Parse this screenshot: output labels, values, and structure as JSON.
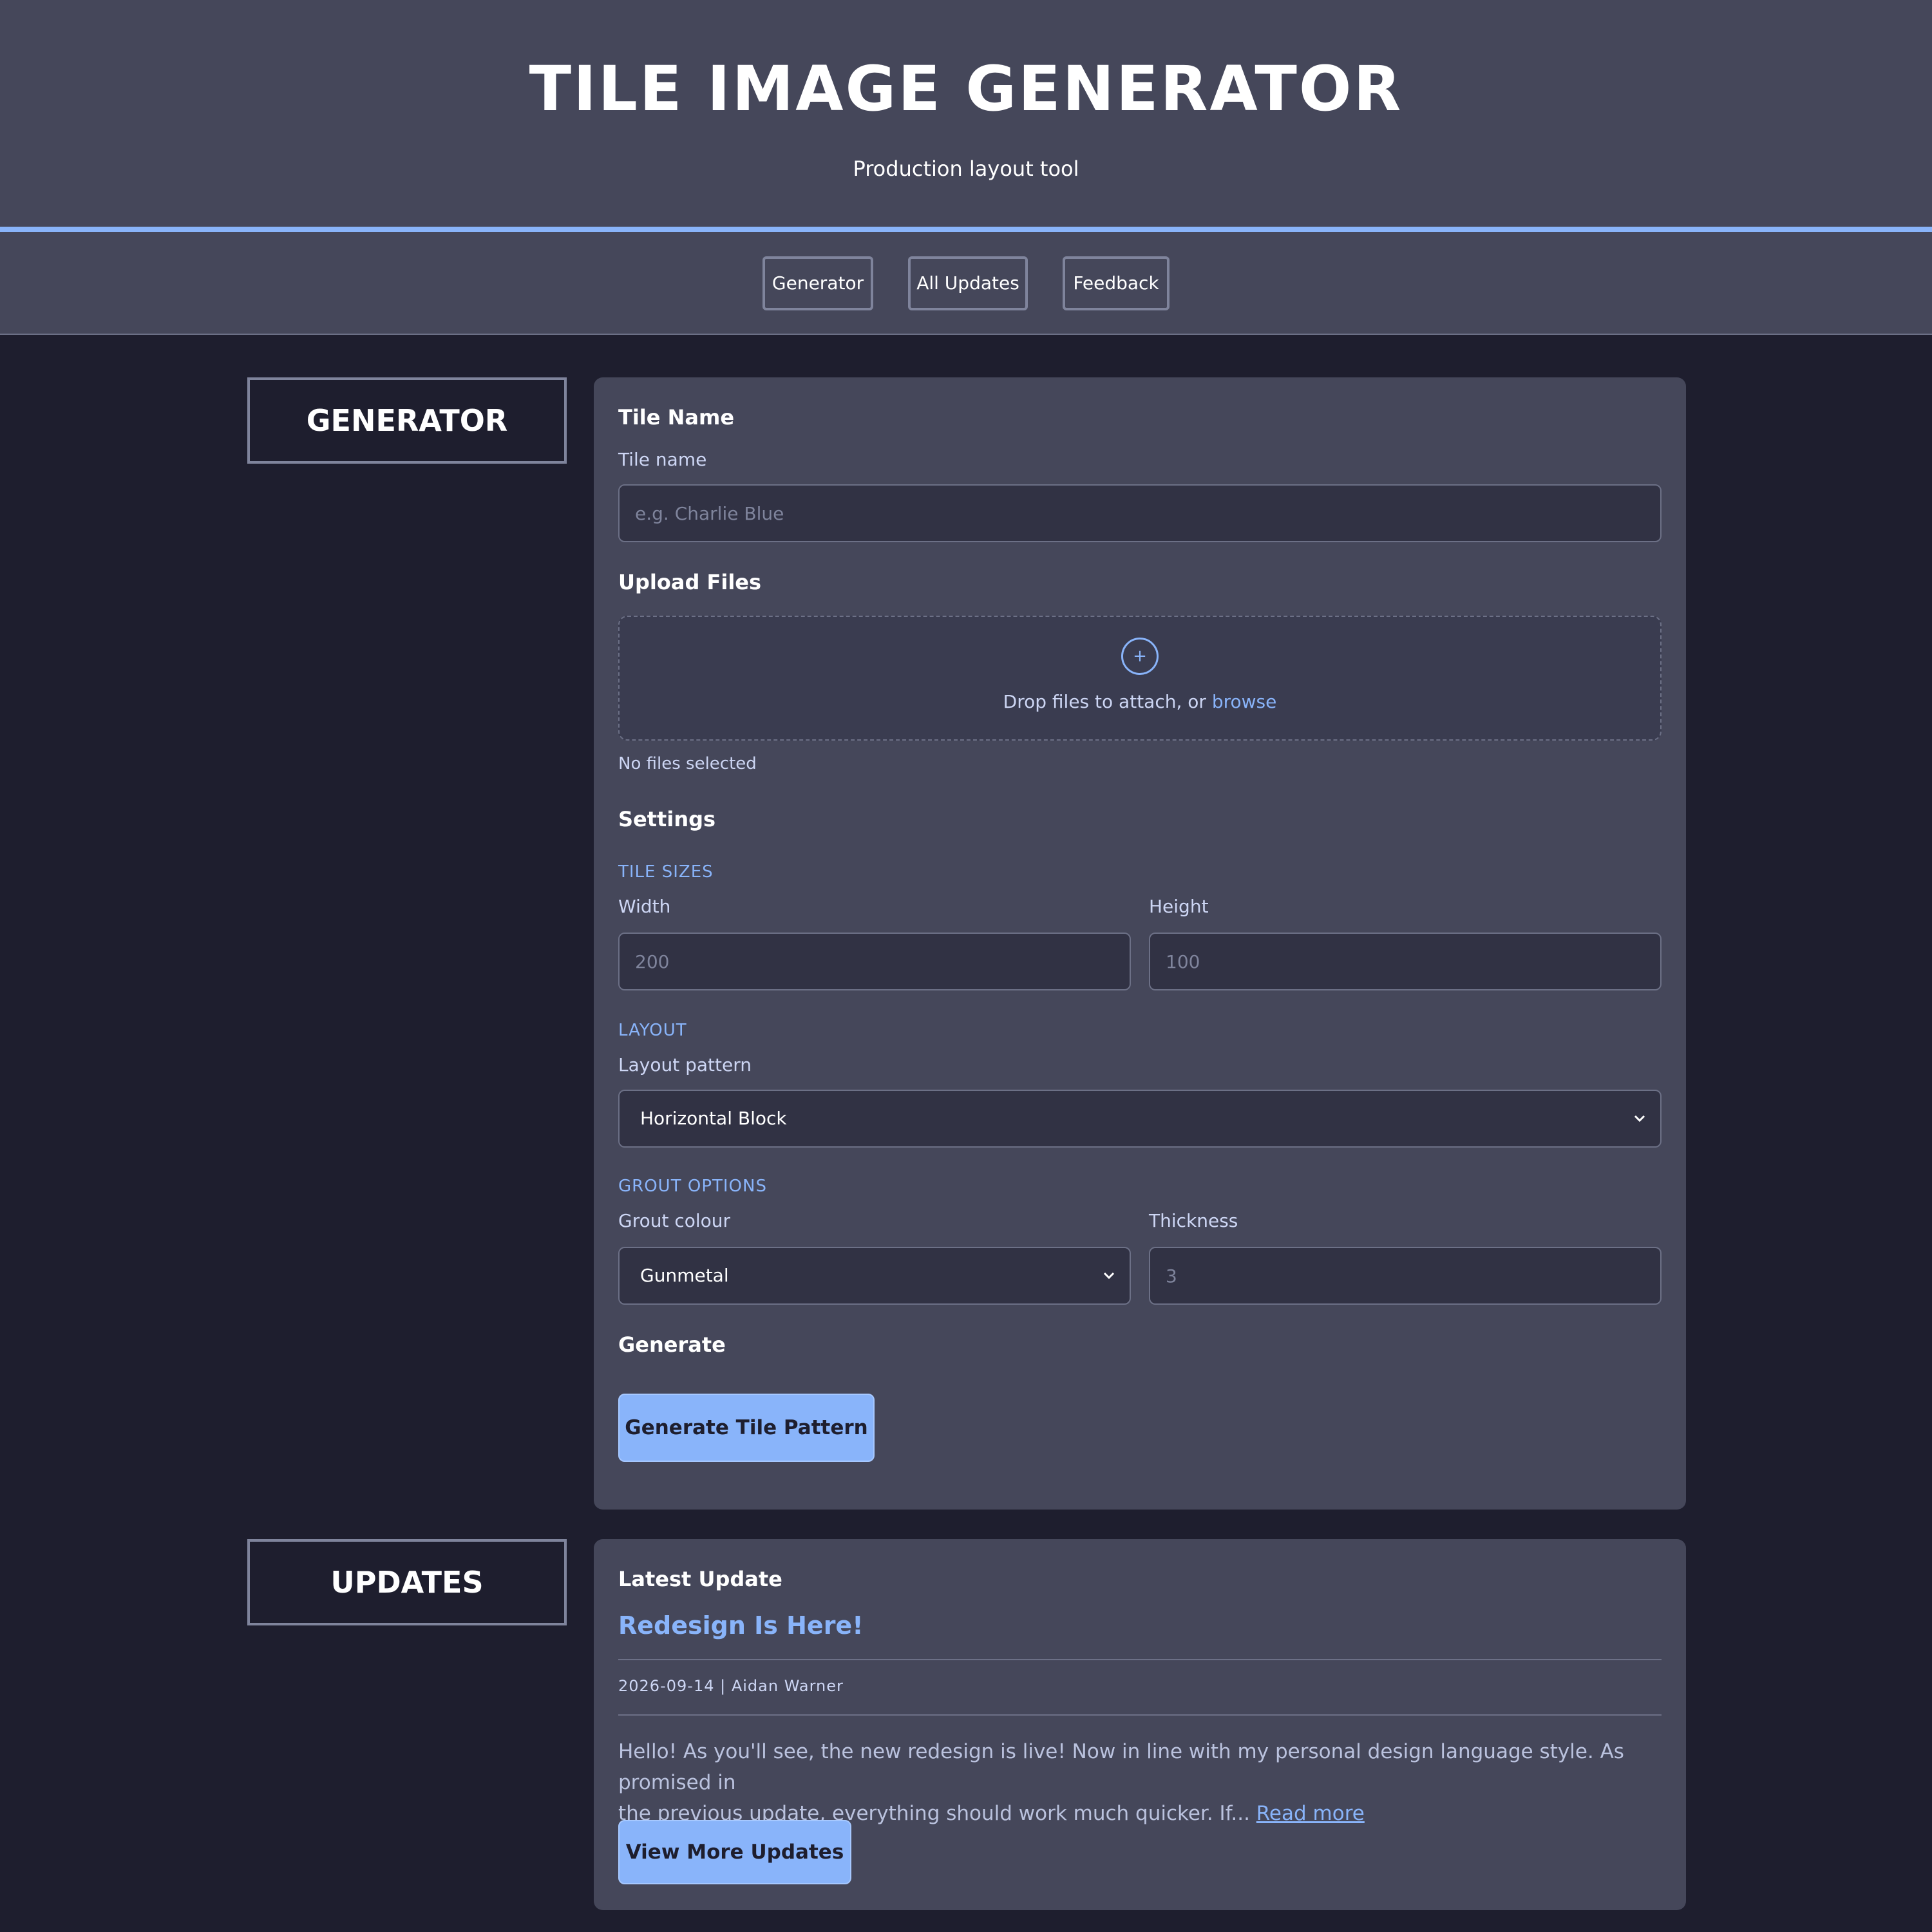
{
  "header": {
    "title": "TILE IMAGE GENERATOR",
    "subtitle": "Production layout tool"
  },
  "nav": {
    "items": [
      {
        "label": "Generator"
      },
      {
        "label": "All Updates"
      },
      {
        "label": "Feedback"
      }
    ]
  },
  "generator": {
    "section_title": "GENERATOR",
    "tile_name": {
      "heading": "Tile Name",
      "label": "Tile name",
      "placeholder": "e.g. Charlie Blue",
      "value": ""
    },
    "upload": {
      "heading": "Upload Files",
      "drop_text": "Drop files to attach, or",
      "browse_label": "browse",
      "status": "No files selected"
    },
    "settings": {
      "heading": "Settings",
      "tile_sizes_label": "TILE SIZES",
      "width_label": "Width",
      "width_placeholder": "200",
      "height_label": "Height",
      "height_placeholder": "100",
      "layout_label": "LAYOUT",
      "layout_pattern_label": "Layout pattern",
      "layout_pattern_value": "Horizontal Block",
      "grout_label": "GROUT OPTIONS",
      "grout_colour_label": "Grout colour",
      "grout_colour_value": "Gunmetal",
      "thickness_label": "Thickness",
      "thickness_placeholder": "3"
    },
    "generate": {
      "heading": "Generate",
      "button_label": "Generate Tile Pattern"
    }
  },
  "updates": {
    "section_title": "UPDATES",
    "heading": "Latest Update",
    "title": "Redesign Is Here!",
    "meta": "2026-09-14 | Aidan Warner",
    "body_line1": "Hello! As you'll see, the new redesign is live! Now in line with my personal design language style. As promised in",
    "body_line2": "the previous update, everything should work much quicker. If...",
    "read_more": "Read more",
    "button_label": "View More Updates"
  },
  "colors": {
    "background": "#1e1e2e",
    "surface": "#45475a",
    "input": "#313244",
    "accent": "#89b4fa"
  }
}
